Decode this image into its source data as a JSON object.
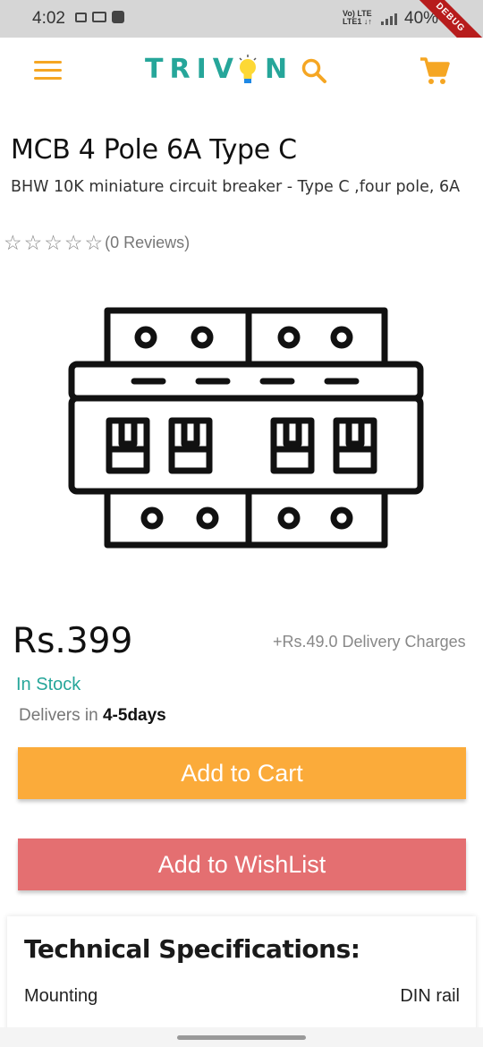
{
  "status_bar": {
    "time": "4:02",
    "network_top": "Vo) LTE",
    "network_bottom": "LTE1 ↓↑",
    "battery": "40%",
    "debug_label": "DEBUG"
  },
  "app_bar": {
    "brand_left": "TRIV",
    "brand_right": "N",
    "colors": {
      "brand": "#26a69a",
      "accent": "#f5a623"
    }
  },
  "product": {
    "title": "MCB 4 Pole 6A Type C",
    "description": "BHW 10K miniature circuit breaker - Type C ,four pole, 6A",
    "rating": {
      "stars_filled": 0,
      "stars_total": 5,
      "reviews_text": "(0 Reviews)"
    },
    "price": "Rs.399",
    "delivery_charges": "+Rs.49.0 Delivery Charges",
    "stock_status": "In Stock",
    "delivers_label": "Delivers in",
    "delivers_value": "4-5days"
  },
  "actions": {
    "add_to_cart": "Add to Cart",
    "add_to_wishlist": "Add to WishList",
    "colors": {
      "cart": "#fbab3a",
      "wishlist": "#e46f71"
    }
  },
  "specifications": {
    "title": "Technical Specifications:",
    "rows": [
      {
        "label": "Mounting",
        "value": "DIN rail"
      }
    ]
  }
}
